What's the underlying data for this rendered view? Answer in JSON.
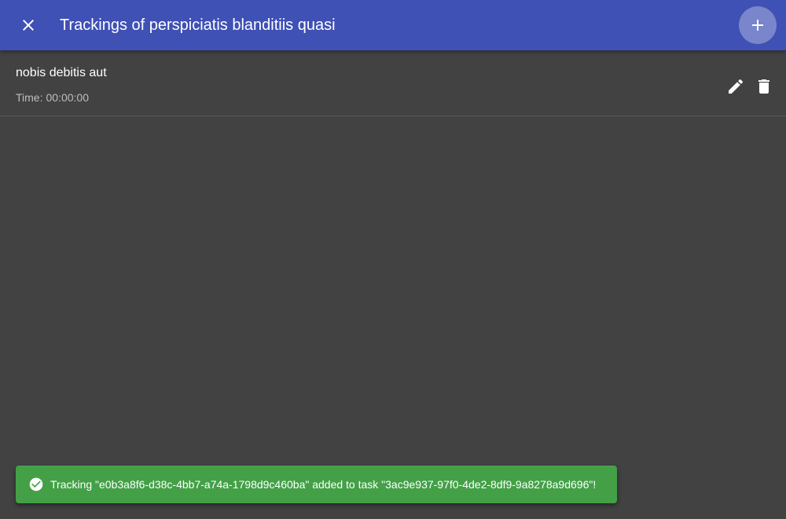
{
  "header": {
    "title": "Trackings of perspiciatis blanditiis quasi",
    "close_icon": "close-icon",
    "add_icon": "plus-icon",
    "color": "#3f51b5",
    "add_button_color": "#7986cb"
  },
  "trackings": [
    {
      "title": "nobis debitis aut",
      "time_label": "Time:",
      "time_value": "00:00:00",
      "edit_icon": "pencil-icon",
      "delete_icon": "trash-icon"
    }
  ],
  "snackbar": {
    "icon": "check-circle-icon",
    "message": "Tracking \"e0b3a8f6-d38c-4bb7-a74a-1798d9c460ba\" added to task \"3ac9e937-97f0-4de2-8df9-9a8278a9d696\"!",
    "color": "#43a047"
  },
  "theme": {
    "background": "#424242"
  }
}
